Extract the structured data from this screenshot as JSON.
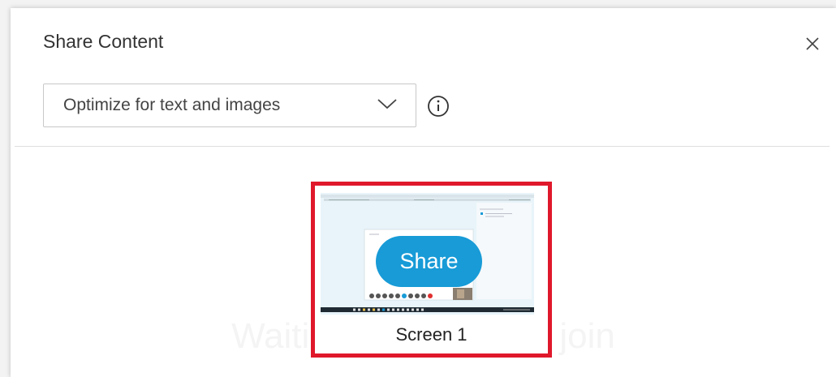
{
  "dialog": {
    "title": "Share Content",
    "close_icon": "close-icon",
    "dropdown": {
      "selected": "Optimize for text and images",
      "icon": "chevron-down-icon"
    },
    "info_icon": "info-icon",
    "background_text": "Waiting for others to join",
    "screen_tile": {
      "label": "Screen 1",
      "share_label": "Share",
      "highlight_color": "#e0182b",
      "accent_color": "#189bd7"
    }
  }
}
